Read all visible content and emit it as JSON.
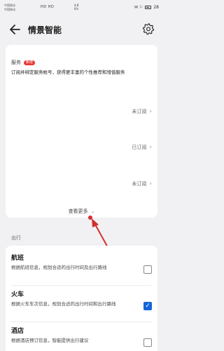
{
  "status_bar": {
    "carrier_line1": "中国移动",
    "carrier_line2": "中国移动",
    "signal": "HD HD",
    "speed_value": "4.8",
    "speed_unit": "K/s",
    "battery_text": "28",
    "right_icons": "✉ ⚐"
  },
  "header": {
    "title": "情景智能"
  },
  "service": {
    "title": "服务",
    "badge": "新增",
    "description": "订阅并绑定服务帐号，获得更丰富的个性推荐和增值服务",
    "rows": [
      {
        "status": "未订阅"
      },
      {
        "status": "已订阅"
      },
      {
        "status": "未订阅"
      }
    ],
    "more_label": "查看更多"
  },
  "travel": {
    "section_label": "出行",
    "items": [
      {
        "title": "航班",
        "description": "根据航班信息，规划合适的出行时间及出行路线",
        "checked": false
      },
      {
        "title": "火车",
        "description": "根据火车车次信息，规划合适的出行时间和出行路线",
        "checked": true
      },
      {
        "title": "酒店",
        "description": "根据酒店预订信息，智能提供出行建议",
        "checked": false
      }
    ]
  },
  "colors": {
    "accent_blue": "#1565d8",
    "badge_red": "#e53935",
    "arrow_red": "#d32f2f"
  }
}
